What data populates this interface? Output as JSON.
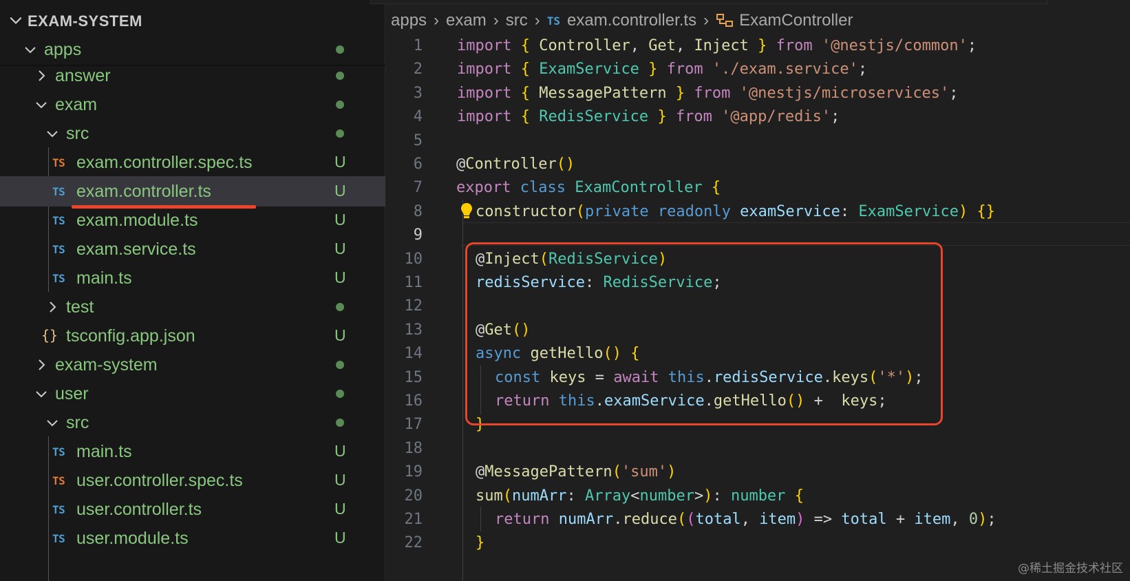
{
  "explorer": {
    "title": "EXAM-SYSTEM",
    "rows": [
      {
        "label": "apps",
        "status": "dot"
      },
      {
        "label": "answer",
        "status": "dot"
      },
      {
        "label": "exam",
        "status": "dot"
      },
      {
        "label": "src",
        "status": "dot"
      },
      {
        "label": "exam.controller.spec.ts",
        "badge": "TS",
        "status": "U"
      },
      {
        "label": "exam.controller.ts",
        "badge": "TS",
        "status": "U"
      },
      {
        "label": "exam.module.ts",
        "badge": "TS",
        "status": "U"
      },
      {
        "label": "exam.service.ts",
        "badge": "TS",
        "status": "U"
      },
      {
        "label": "main.ts",
        "badge": "TS",
        "status": "U"
      },
      {
        "label": "test",
        "status": "dot"
      },
      {
        "label": "tsconfig.app.json",
        "badge": "{}",
        "status": "U"
      },
      {
        "label": "exam-system",
        "status": "dot"
      },
      {
        "label": "user",
        "status": "dot"
      },
      {
        "label": "src",
        "status": "dot"
      },
      {
        "label": "main.ts",
        "badge": "TS",
        "status": "U"
      },
      {
        "label": "user.controller.spec.ts",
        "badge": "TS",
        "status": "U"
      },
      {
        "label": "user.controller.ts",
        "badge": "TS",
        "status": "U"
      },
      {
        "label": "user.module.ts",
        "badge": "TS",
        "status": "U"
      }
    ]
  },
  "breadcrumb": {
    "apps": "apps",
    "exam": "exam",
    "src": "src",
    "ts_badge": "TS",
    "file": "exam.controller.ts",
    "symbol": "ExamController"
  },
  "code": {
    "line_numbers": [
      "1",
      "2",
      "3",
      "4",
      "5",
      "6",
      "7",
      "8",
      "9",
      "10",
      "11",
      "12",
      "13",
      "14",
      "15",
      "16",
      "17",
      "18",
      "19",
      "20",
      "21",
      "22"
    ],
    "lines": [
      "import { Controller, Get, Inject } from '@nestjs/common';",
      "import { ExamService } from './exam.service';",
      "import { MessagePattern } from '@nestjs/microservices';",
      "import { RedisService } from '@app/redis';",
      "",
      "@Controller()",
      "export class ExamController {",
      "constructor(private readonly examService: ExamService) {}",
      "",
      "@Inject(RedisService)",
      "redisService: RedisService;",
      "",
      "@Get()",
      "async getHello() {",
      "const keys = await this.redisService.keys('*');",
      "return this.examService.getHello() +  keys;",
      "}",
      "",
      "@MessagePattern('sum')",
      "sum(numArr: Array<number>): number {",
      "return numArr.reduce((total, item) => total + item, 0);",
      "}"
    ]
  },
  "watermark": "@稀土掘金技术社区",
  "colors": {
    "accent_red": "#e8452c",
    "untracked_green": "#89c77f",
    "ts_blue": "#4d9fd6",
    "ts_spec_orange": "#e37933"
  }
}
